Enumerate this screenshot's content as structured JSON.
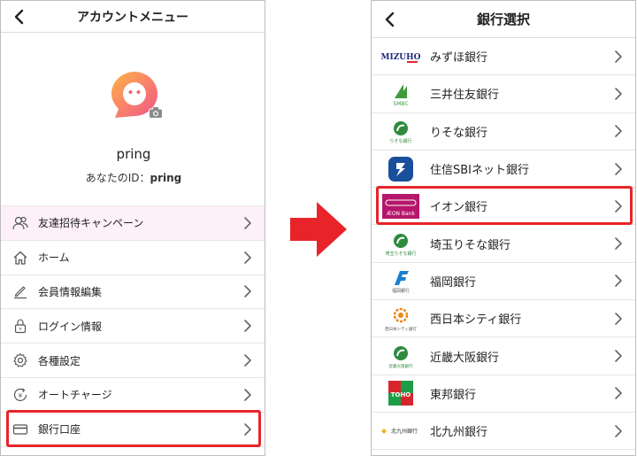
{
  "left_screen": {
    "title": "アカウントメニュー",
    "username": "pring",
    "user_id_label": "あなたのID：",
    "user_id_value": "pring",
    "menu": [
      {
        "label": "友達招待キャンペーン",
        "icon": "invite-friends-icon"
      },
      {
        "label": "ホーム",
        "icon": "home-icon"
      },
      {
        "label": "会員情報編集",
        "icon": "edit-pencil-icon"
      },
      {
        "label": "ログイン情報",
        "icon": "lock-icon"
      },
      {
        "label": "各種設定",
        "icon": "gear-icon"
      },
      {
        "label": "オートチャージ",
        "icon": "auto-charge-icon"
      },
      {
        "label": "銀行口座",
        "icon": "credit-card-icon"
      }
    ]
  },
  "right_screen": {
    "title": "銀行選択",
    "banks": [
      {
        "name": "みずほ銀行",
        "logo_text": "MIZUHO"
      },
      {
        "name": "三井住友銀行",
        "logo_text": "SMBC"
      },
      {
        "name": "りそな銀行",
        "logo_text": "りそな銀行"
      },
      {
        "name": "住信SBIネット銀行",
        "logo_text": ""
      },
      {
        "name": "イオン銀行",
        "logo_text": "ÆON Bank"
      },
      {
        "name": "埼玉りそな銀行",
        "logo_text": "埼玉りそな銀行"
      },
      {
        "name": "福岡銀行",
        "logo_text": "福岡銀行"
      },
      {
        "name": "西日本シティ銀行",
        "logo_text": "西日本シティ銀行"
      },
      {
        "name": "近畿大阪銀行",
        "logo_text": "近畿大阪銀行"
      },
      {
        "name": "東邦銀行",
        "logo_text": "TOHO"
      },
      {
        "name": "北九州銀行",
        "logo_text": "北九州銀行"
      }
    ]
  },
  "colors": {
    "highlight_box": "#e8242a",
    "arrow": "#e8242a",
    "invite_row_bg": "#fdf0f8"
  }
}
